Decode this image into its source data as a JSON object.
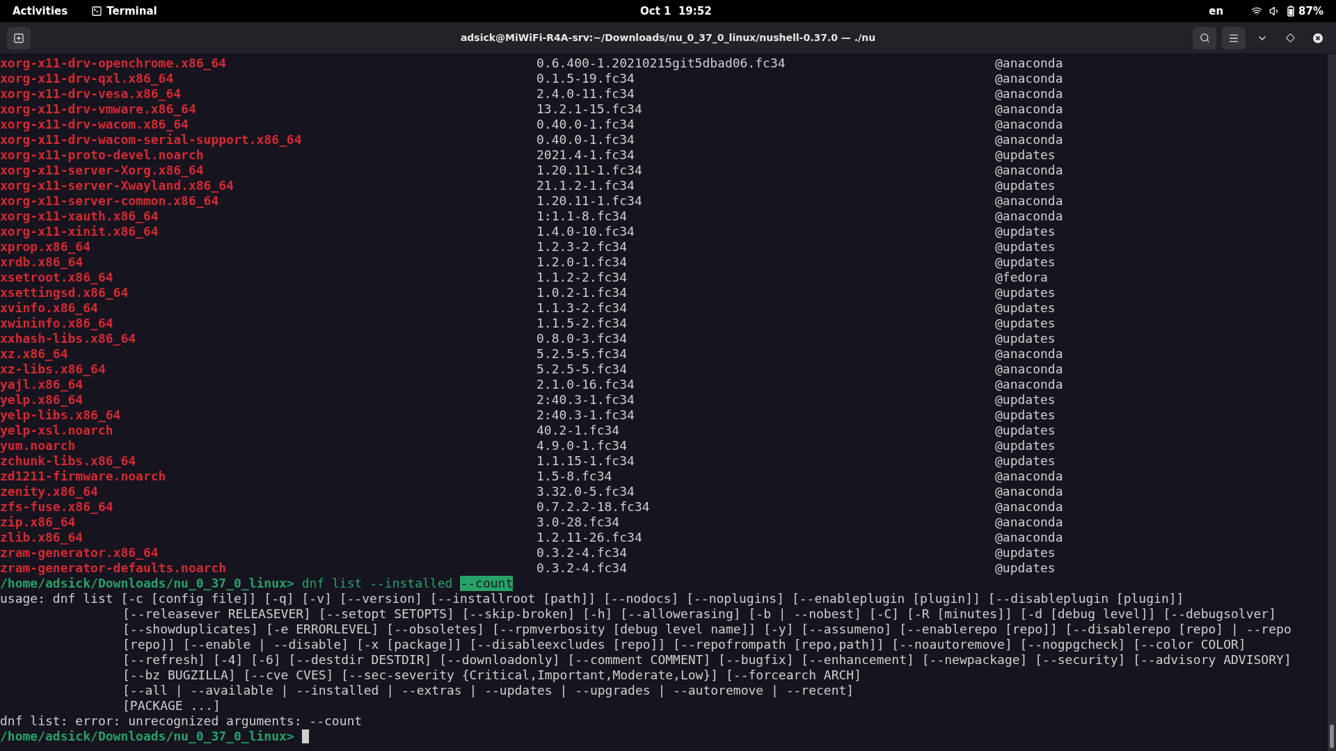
{
  "top_bar": {
    "activities": "Activities",
    "app_name": "Terminal",
    "clock": "Oct 1  19:52",
    "language": "en",
    "battery": "87%"
  },
  "window": {
    "title": "adsick@MiWiFi-R4A-srv:~/Downloads/nu_0_37_0_linux/nushell-0.37.0 — ./nu"
  },
  "packages": [
    {
      "name": "xorg-x11-drv-openchrome.x86_64",
      "version": "0.6.400-1.20210215git5dbad06.fc34",
      "repo": "@anaconda"
    },
    {
      "name": "xorg-x11-drv-qxl.x86_64",
      "version": "0.1.5-19.fc34",
      "repo": "@anaconda"
    },
    {
      "name": "xorg-x11-drv-vesa.x86_64",
      "version": "2.4.0-11.fc34",
      "repo": "@anaconda"
    },
    {
      "name": "xorg-x11-drv-vmware.x86_64",
      "version": "13.2.1-15.fc34",
      "repo": "@anaconda"
    },
    {
      "name": "xorg-x11-drv-wacom.x86_64",
      "version": "0.40.0-1.fc34",
      "repo": "@anaconda"
    },
    {
      "name": "xorg-x11-drv-wacom-serial-support.x86_64",
      "version": "0.40.0-1.fc34",
      "repo": "@anaconda"
    },
    {
      "name": "xorg-x11-proto-devel.noarch",
      "version": "2021.4-1.fc34",
      "repo": "@updates"
    },
    {
      "name": "xorg-x11-server-Xorg.x86_64",
      "version": "1.20.11-1.fc34",
      "repo": "@anaconda"
    },
    {
      "name": "xorg-x11-server-Xwayland.x86_64",
      "version": "21.1.2-1.fc34",
      "repo": "@updates"
    },
    {
      "name": "xorg-x11-server-common.x86_64",
      "version": "1.20.11-1.fc34",
      "repo": "@anaconda"
    },
    {
      "name": "xorg-x11-xauth.x86_64",
      "version": "1:1.1-8.fc34",
      "repo": "@anaconda"
    },
    {
      "name": "xorg-x11-xinit.x86_64",
      "version": "1.4.0-10.fc34",
      "repo": "@updates"
    },
    {
      "name": "xprop.x86_64",
      "version": "1.2.3-2.fc34",
      "repo": "@updates"
    },
    {
      "name": "xrdb.x86_64",
      "version": "1.2.0-1.fc34",
      "repo": "@updates"
    },
    {
      "name": "xsetroot.x86_64",
      "version": "1.1.2-2.fc34",
      "repo": "@fedora"
    },
    {
      "name": "xsettingsd.x86_64",
      "version": "1.0.2-1.fc34",
      "repo": "@updates"
    },
    {
      "name": "xvinfo.x86_64",
      "version": "1.1.3-2.fc34",
      "repo": "@updates"
    },
    {
      "name": "xwininfo.x86_64",
      "version": "1.1.5-2.fc34",
      "repo": "@updates"
    },
    {
      "name": "xxhash-libs.x86_64",
      "version": "0.8.0-3.fc34",
      "repo": "@updates"
    },
    {
      "name": "xz.x86_64",
      "version": "5.2.5-5.fc34",
      "repo": "@anaconda"
    },
    {
      "name": "xz-libs.x86_64",
      "version": "5.2.5-5.fc34",
      "repo": "@anaconda"
    },
    {
      "name": "yajl.x86_64",
      "version": "2.1.0-16.fc34",
      "repo": "@anaconda"
    },
    {
      "name": "yelp.x86_64",
      "version": "2:40.3-1.fc34",
      "repo": "@updates"
    },
    {
      "name": "yelp-libs.x86_64",
      "version": "2:40.3-1.fc34",
      "repo": "@updates"
    },
    {
      "name": "yelp-xsl.noarch",
      "version": "40.2-1.fc34",
      "repo": "@updates"
    },
    {
      "name": "yum.noarch",
      "version": "4.9.0-1.fc34",
      "repo": "@updates"
    },
    {
      "name": "zchunk-libs.x86_64",
      "version": "1.1.15-1.fc34",
      "repo": "@updates"
    },
    {
      "name": "zd1211-firmware.noarch",
      "version": "1.5-8.fc34",
      "repo": "@anaconda"
    },
    {
      "name": "zenity.x86_64",
      "version": "3.32.0-5.fc34",
      "repo": "@anaconda"
    },
    {
      "name": "zfs-fuse.x86_64",
      "version": "0.7.2.2-18.fc34",
      "repo": "@anaconda"
    },
    {
      "name": "zip.x86_64",
      "version": "3.0-28.fc34",
      "repo": "@anaconda"
    },
    {
      "name": "zlib.x86_64",
      "version": "1.2.11-26.fc34",
      "repo": "@anaconda"
    },
    {
      "name": "zram-generator.x86_64",
      "version": "0.3.2-4.fc34",
      "repo": "@updates"
    },
    {
      "name": "zram-generator-defaults.noarch",
      "version": "0.3.2-4.fc34",
      "repo": "@updates"
    }
  ],
  "command_prompt": {
    "path": "/home/adsick/Downloads/nu_0_37_0_linux>",
    "tokens": [
      {
        "text": "dnf list --installed",
        "highlighted": false
      },
      {
        "text": "--count",
        "highlighted": true
      }
    ]
  },
  "usage_lines": [
    "usage: dnf list [-c [config file]] [-q] [-v] [--version] [--installroot [path]] [--nodocs] [--noplugins] [--enableplugin [plugin]] [--disableplugin [plugin]]",
    "[--releasever RELEASEVER] [--setopt SETOPTS] [--skip-broken] [-h] [--allowerasing] [-b | --nobest] [-C] [-R [minutes]] [-d [debug level]] [--debugsolver]",
    "[--showduplicates] [-e ERRORLEVEL] [--obsoletes] [--rpmverbosity [debug level name]] [-y] [--assumeno] [--enablerepo [repo]] [--disablerepo [repo] | --repo",
    "[repo]] [--enable | --disable] [-x [package]] [--disableexcludes [repo]] [--repofrompath [repo,path]] [--noautoremove] [--nogpgcheck] [--color COLOR]",
    "[--refresh] [-4] [-6] [--destdir DESTDIR] [--downloadonly] [--comment COMMENT] [--bugfix] [--enhancement] [--newpackage] [--security] [--advisory ADVISORY]",
    "[--bz BUGZILLA] [--cve CVES] [--sec-severity {Critical,Important,Moderate,Low}] [--forcearch ARCH]",
    "[--all | --available | --installed | --extras | --updates | --upgrades | --autoremove | --recent]",
    "[PACKAGE ...]"
  ],
  "error_line": "dnf list: error: unrecognized arguments: --count",
  "final_prompt": {
    "path": "/home/adsick/Downloads/nu_0_37_0_linux>"
  }
}
